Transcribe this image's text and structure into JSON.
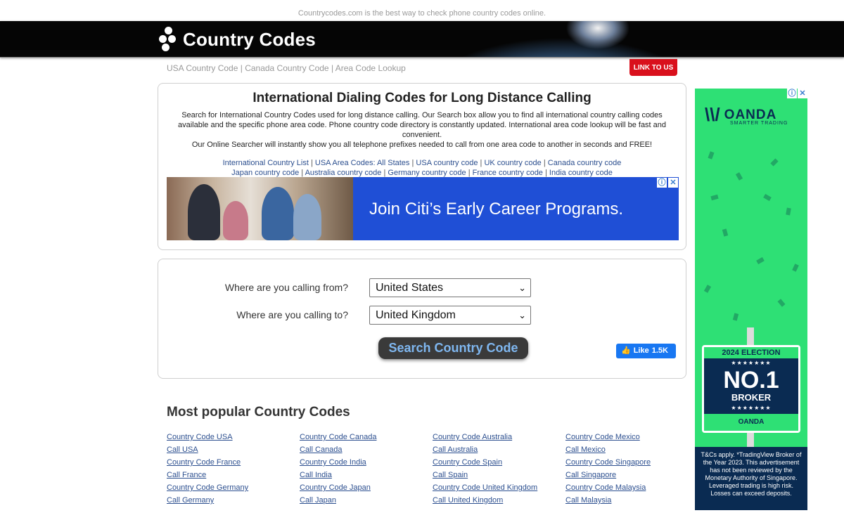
{
  "header": {
    "tagline": "Countrycodes.com is the best way to check phone country codes online.",
    "logo_text": "Country Codes"
  },
  "subnav": {
    "items": [
      "USA Country Code",
      "Canada Country Code",
      "Area Code Lookup"
    ],
    "link_us": "LINK TO US"
  },
  "intro": {
    "title": "International Dialing Codes for Long Distance Calling",
    "paragraph1": "Search for International Country Codes used for long distance calling. Our Search box allow you to find all international country calling codes available and the specific phone area code. Phone country code directory is constantly updated. International area code lookup will be fast and convenient.",
    "paragraph2": "Our Online Searcher will instantly show you all telephone prefixes needed to call from one area code to another in seconds and FREE!",
    "links_row1": [
      "International Country List",
      "USA Area Codes: All States",
      "USA country code",
      "UK country code",
      "Canada country code"
    ],
    "links_row2": [
      "Japan country code",
      "Australia country code",
      "Germany country code",
      "France country code",
      "India country code"
    ]
  },
  "ad_banner": {
    "text": "Join Citi’s Early Career Programs."
  },
  "search_form": {
    "from_label": "Where are you calling from?",
    "from_value": "United States",
    "to_label": "Where are you calling to?",
    "to_value": "United Kingdom",
    "button_label": "Search Country Code",
    "like_label": "Like",
    "like_count": "1.5K"
  },
  "popular": {
    "heading": "Most popular Country Codes",
    "links": [
      "Country Code USA",
      "Country Code Canada",
      "Country Code Australia",
      "Country Code Mexico",
      "Call USA",
      "Call Canada",
      "Call Australia",
      "Call Mexico",
      "Country Code France",
      "Country Code India",
      "Country Code Spain",
      "Country Code Singapore",
      "Call France",
      "Call India",
      "Call Spain",
      "Call Singapore",
      "Country Code Germany",
      "Country Code Japan",
      "Country Code United Kingdom",
      "Country Code Malaysia",
      "Call Germany",
      "Call Japan",
      "Call United Kingdom",
      "Call Malaysia"
    ]
  },
  "side_ad": {
    "brand": "OANDA",
    "brand_sub": "SMARTER TRADING",
    "sign_year": "2024 ELECTION",
    "sign_no1": "NO.1",
    "sign_broker": "BROKER",
    "sign_brand": "OANDA",
    "disclaimer": "T&Cs apply. *TradingView Broker of the Year 2023. This advertisement has not been reviewed by the Monetary Authority of Singapore. Leveraged trading is high risk. Losses can exceed deposits."
  },
  "colors": {
    "link": "#2c4f8f",
    "link_us_bg": "#d9101c",
    "ad_blue": "#1f4fd6",
    "oanda_green": "#2ee075",
    "oanda_navy": "#0a2b52",
    "facebook_blue": "#1877f2"
  }
}
